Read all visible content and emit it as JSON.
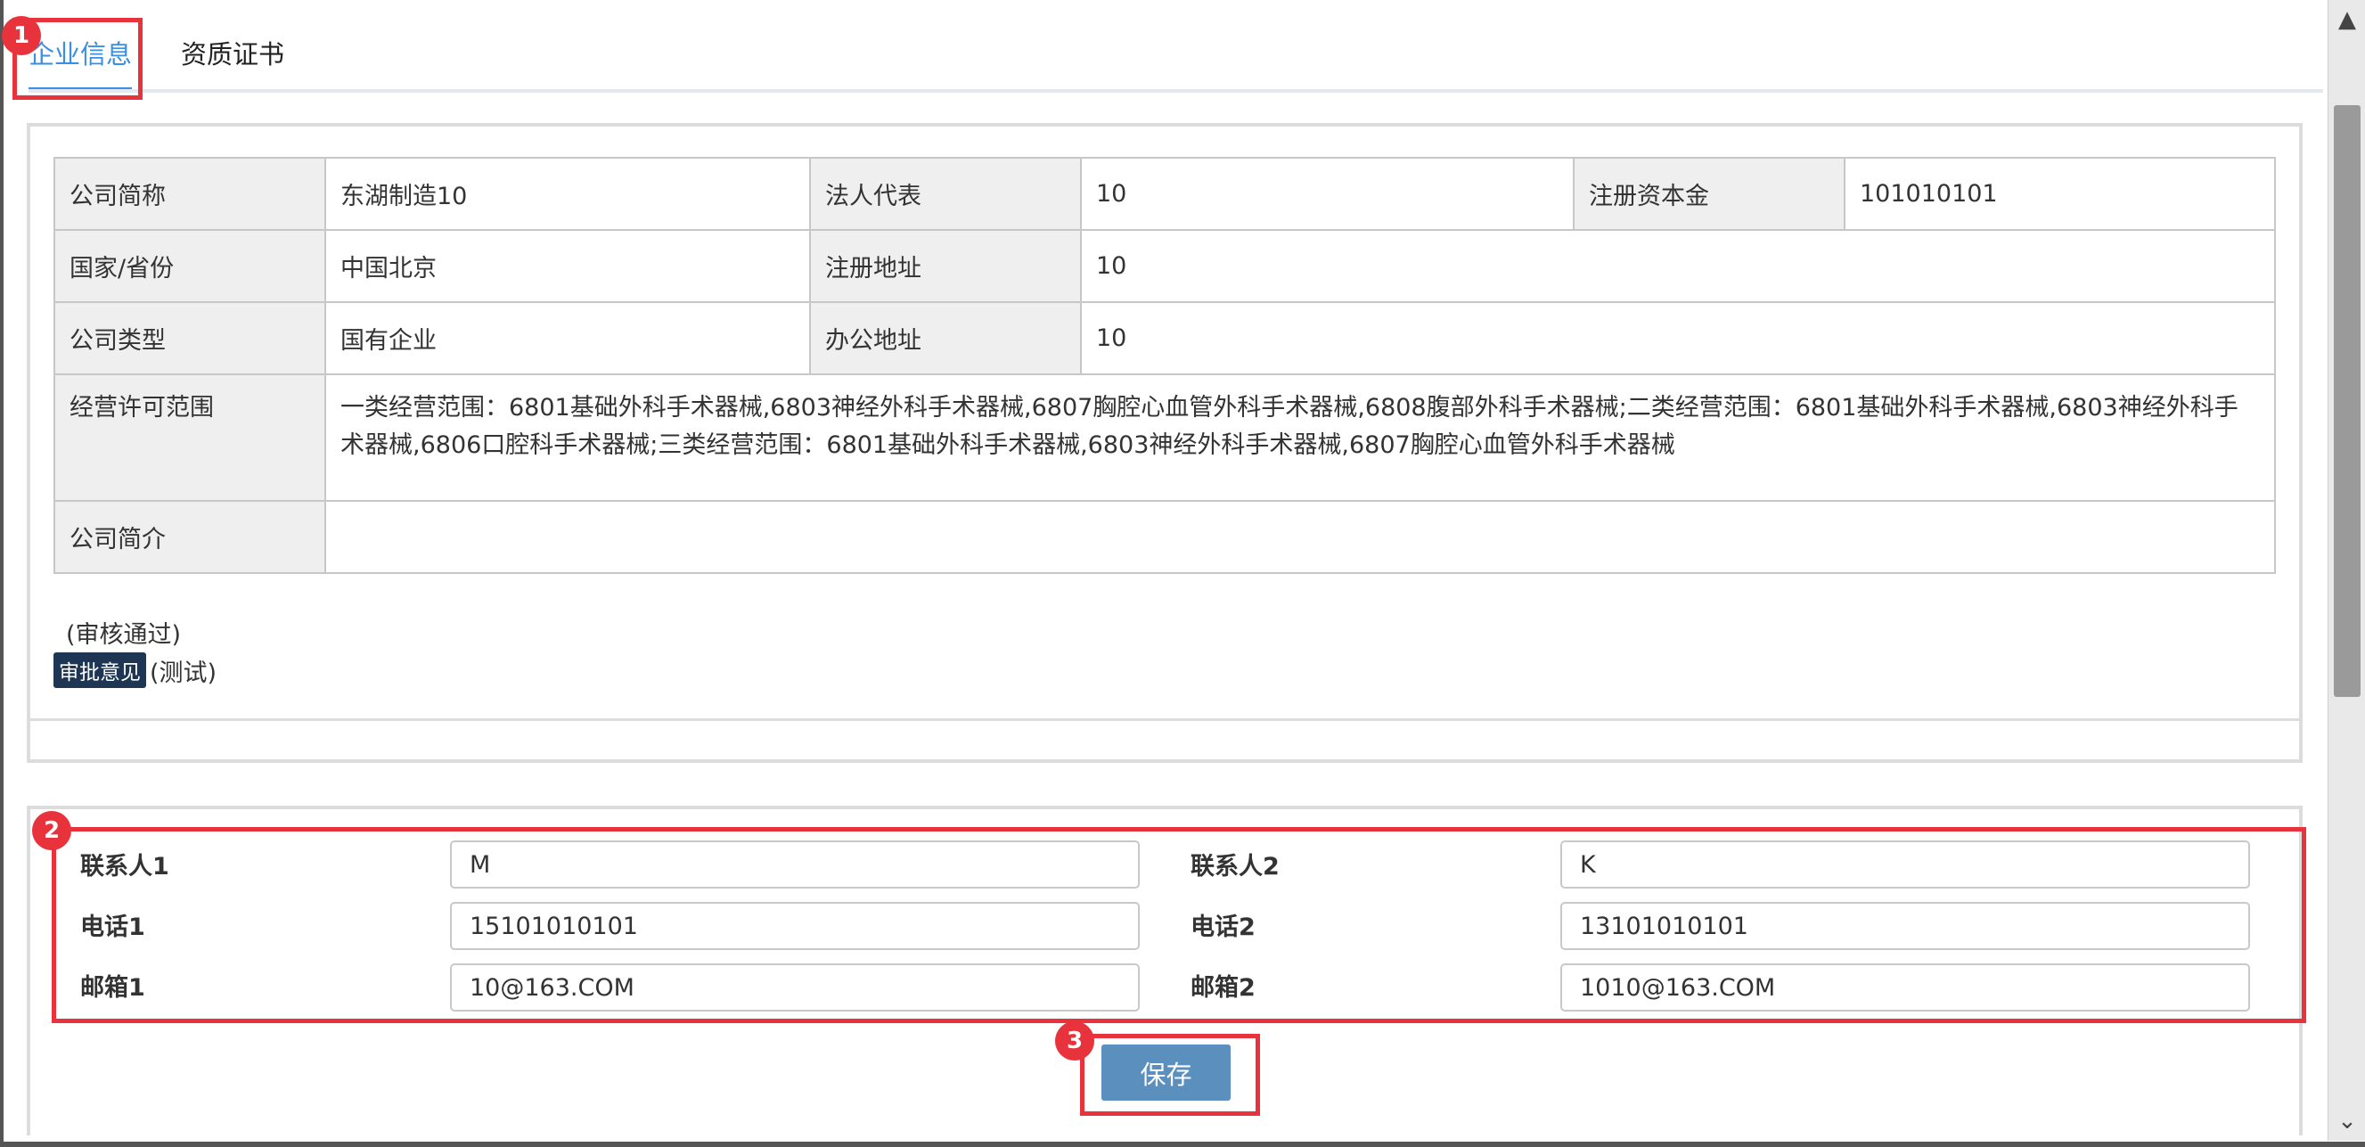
{
  "tabs": [
    {
      "label": "企业信息",
      "active": true
    },
    {
      "label": "资质证书",
      "active": false
    }
  ],
  "company": {
    "short_name_label": "公司简称",
    "short_name": "东湖制造10",
    "legal_rep_label": "法人代表",
    "legal_rep": "10",
    "capital_label": "注册资本金",
    "capital": "101010101",
    "region_label": "国家/省份",
    "region": "中国北京",
    "reg_address_label": "注册地址",
    "reg_address": "10",
    "type_label": "公司类型",
    "type": "国有企业",
    "office_address_label": "办公地址",
    "office_address": "10",
    "license_scope_label": "经营许可范围",
    "license_scope": "一类经营范围：6801基础外科手术器械,6803神经外科手术器械,6807胸腔心血管外科手术器械,6808腹部外科手术器械;二类经营范围：6801基础外科手术器械,6803神经外科手术器械,6806口腔科手术器械;三类经营范围：6801基础外科手术器械,6803神经外科手术器械,6807胸腔心血管外科手术器械",
    "intro_label": "公司简介",
    "intro": ""
  },
  "audit": {
    "status": "(审核通过)",
    "badge": "审批意见",
    "comment": "(测试)"
  },
  "contacts": {
    "contact1_label": "联系人1",
    "contact1": "M",
    "contact2_label": "联系人2",
    "contact2": "K",
    "phone1_label": "电话1",
    "phone1": "15101010101",
    "phone2_label": "电话2",
    "phone2": "13101010101",
    "email1_label": "邮箱1",
    "email1": "10@163.COM",
    "email2_label": "邮箱2",
    "email2": "1010@163.COM"
  },
  "save_label": "保存",
  "markers": [
    "1",
    "2",
    "3"
  ],
  "colors": {
    "accent": "#3a8ee6",
    "highlight": "#e8323c",
    "button": "#5b8fbe",
    "badge": "#1e3653"
  },
  "icons": {
    "scroll_up": "chevron-up-icon",
    "scroll_down": "chevron-down-icon"
  }
}
